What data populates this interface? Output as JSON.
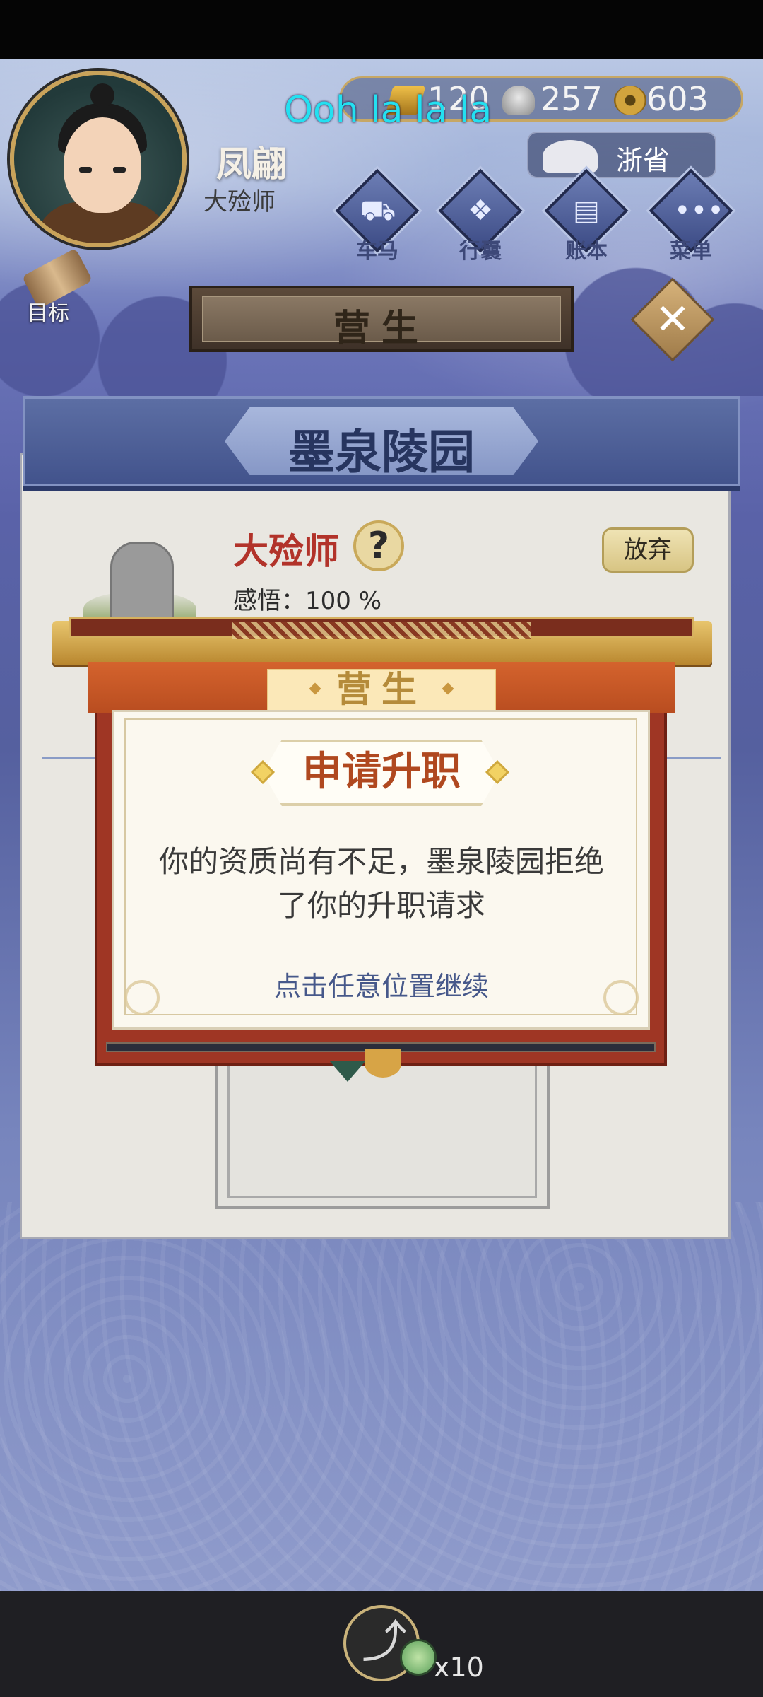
{
  "overlay_text": "Ooh la la la",
  "player": {
    "name": "凤翩",
    "title": "大殓师"
  },
  "currencies": {
    "gold": "120",
    "silver": "257",
    "coins": "603"
  },
  "province_button": "浙省",
  "nav": {
    "carriage": "车马",
    "bag": "行囊",
    "ledger": "账本",
    "menu": "菜单",
    "target": "目标"
  },
  "page_title": "营生",
  "panel": {
    "place": "墨泉陵园",
    "job_title": "大殓师",
    "help": "?",
    "insight": "感悟：100 %",
    "abandon": "放弃"
  },
  "modal": {
    "band_label": "营生",
    "heading": "申请升职",
    "message_line1": "你的资质尚有不足，墨泉陵园拒绝",
    "message_line2": "了你的升职请求",
    "continue_hint": "点击任意位置继续"
  },
  "share": {
    "count": "x10"
  },
  "colors": {
    "accent_red": "#b0481f",
    "job_title_red": "#b2332a",
    "hint_blue": "#46588a",
    "overlay_cyan": "#23e0f0"
  },
  "icons": {
    "gold": "gold-ingot-icon",
    "silver": "silver-ingot-icon",
    "coin": "copper-coin-icon",
    "province": "teapot-icon",
    "carriage": "carriage-icon",
    "bag": "bag-icon",
    "ledger": "ledger-icon",
    "menu": "more-dots-icon",
    "target": "scroll-icon",
    "close": "close-icon",
    "share": "share-icon"
  }
}
